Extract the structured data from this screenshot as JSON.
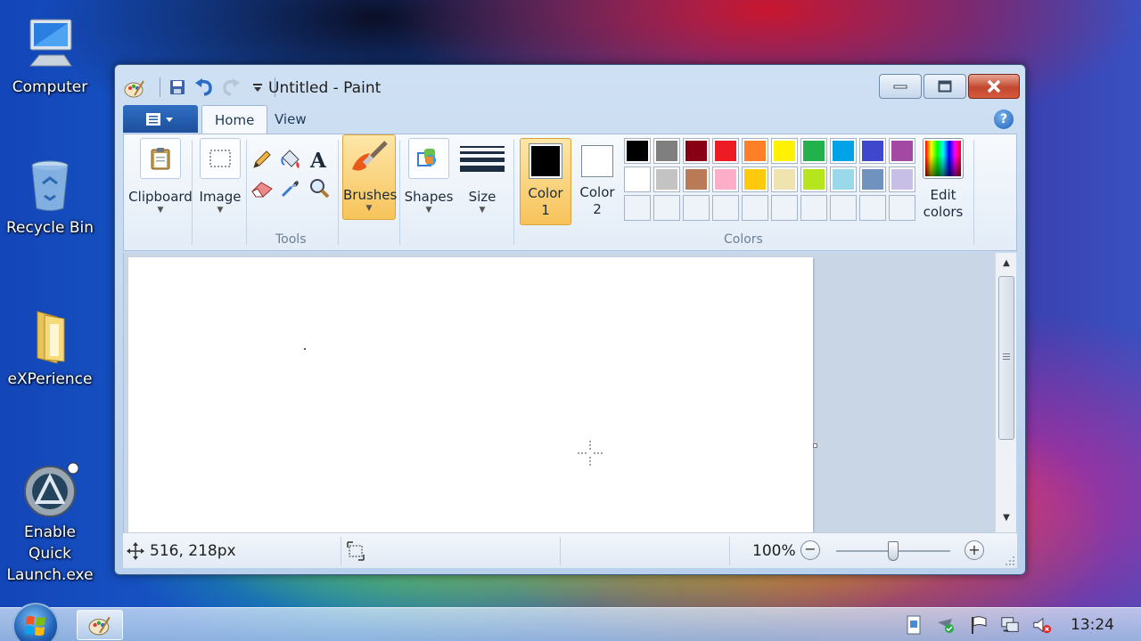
{
  "desktop": {
    "icons": [
      {
        "label": "Computer"
      },
      {
        "label": "Recycle Bin"
      },
      {
        "label": "eXPerience"
      },
      {
        "label_line1": "Enable Quick",
        "label_line2": "Launch.exe"
      }
    ]
  },
  "window": {
    "title": "Untitled - Paint",
    "tabs": [
      "Home",
      "View"
    ],
    "help": "?",
    "ribbon": {
      "clipboard": "Clipboard",
      "image": "Image",
      "tools_caption": "Tools",
      "brushes": "Brushes",
      "shapes": "Shapes",
      "size": "Size",
      "color1_line1": "Color",
      "color1_line2": "1",
      "color2_line1": "Color",
      "color2_line2": "2",
      "colors_caption": "Colors",
      "edit_colors_line1": "Edit",
      "edit_colors_line2": "colors",
      "color1_value": "#000000",
      "color2_value": "#ffffff",
      "palette": [
        "#000000",
        "#7f7f7f",
        "#880015",
        "#ed1c24",
        "#ff7f27",
        "#fff200",
        "#22b14c",
        "#00a2e8",
        "#3f48cc",
        "#a349a4",
        "#ffffff",
        "#c3c3c3",
        "#b97a57",
        "#ffaec9",
        "#ffc90e",
        "#efe4b0",
        "#b5e61d",
        "#99d9ea",
        "#7092be",
        "#c8bfe7"
      ]
    },
    "status": {
      "cursor_position": "516, 218px",
      "zoom": "100%"
    }
  },
  "taskbar": {
    "clock": "13:24"
  }
}
